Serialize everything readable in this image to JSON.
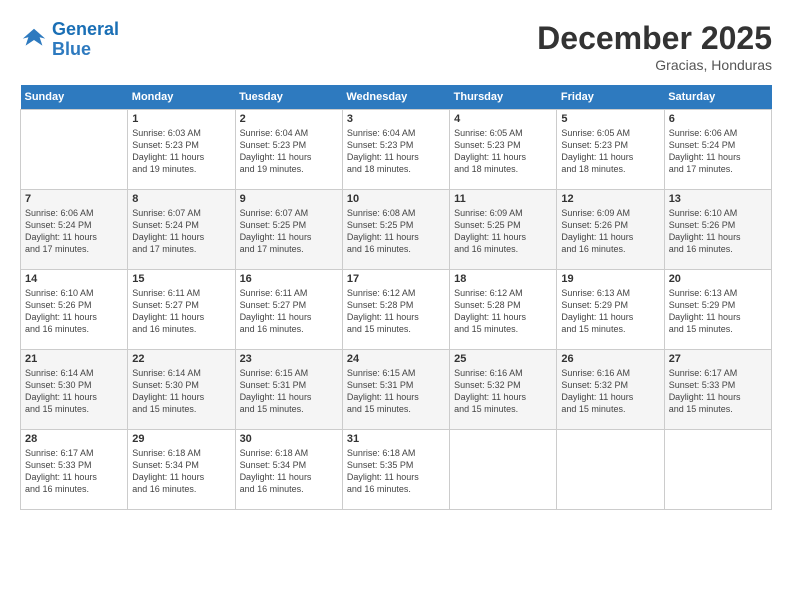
{
  "header": {
    "logo_line1": "General",
    "logo_line2": "Blue",
    "month": "December 2025",
    "location": "Gracias, Honduras"
  },
  "days_of_week": [
    "Sunday",
    "Monday",
    "Tuesday",
    "Wednesday",
    "Thursday",
    "Friday",
    "Saturday"
  ],
  "weeks": [
    [
      {
        "num": "",
        "info": ""
      },
      {
        "num": "1",
        "info": "Sunrise: 6:03 AM\nSunset: 5:23 PM\nDaylight: 11 hours\nand 19 minutes."
      },
      {
        "num": "2",
        "info": "Sunrise: 6:04 AM\nSunset: 5:23 PM\nDaylight: 11 hours\nand 19 minutes."
      },
      {
        "num": "3",
        "info": "Sunrise: 6:04 AM\nSunset: 5:23 PM\nDaylight: 11 hours\nand 18 minutes."
      },
      {
        "num": "4",
        "info": "Sunrise: 6:05 AM\nSunset: 5:23 PM\nDaylight: 11 hours\nand 18 minutes."
      },
      {
        "num": "5",
        "info": "Sunrise: 6:05 AM\nSunset: 5:23 PM\nDaylight: 11 hours\nand 18 minutes."
      },
      {
        "num": "6",
        "info": "Sunrise: 6:06 AM\nSunset: 5:24 PM\nDaylight: 11 hours\nand 17 minutes."
      }
    ],
    [
      {
        "num": "7",
        "info": "Sunrise: 6:06 AM\nSunset: 5:24 PM\nDaylight: 11 hours\nand 17 minutes."
      },
      {
        "num": "8",
        "info": "Sunrise: 6:07 AM\nSunset: 5:24 PM\nDaylight: 11 hours\nand 17 minutes."
      },
      {
        "num": "9",
        "info": "Sunrise: 6:07 AM\nSunset: 5:25 PM\nDaylight: 11 hours\nand 17 minutes."
      },
      {
        "num": "10",
        "info": "Sunrise: 6:08 AM\nSunset: 5:25 PM\nDaylight: 11 hours\nand 16 minutes."
      },
      {
        "num": "11",
        "info": "Sunrise: 6:09 AM\nSunset: 5:25 PM\nDaylight: 11 hours\nand 16 minutes."
      },
      {
        "num": "12",
        "info": "Sunrise: 6:09 AM\nSunset: 5:26 PM\nDaylight: 11 hours\nand 16 minutes."
      },
      {
        "num": "13",
        "info": "Sunrise: 6:10 AM\nSunset: 5:26 PM\nDaylight: 11 hours\nand 16 minutes."
      }
    ],
    [
      {
        "num": "14",
        "info": "Sunrise: 6:10 AM\nSunset: 5:26 PM\nDaylight: 11 hours\nand 16 minutes."
      },
      {
        "num": "15",
        "info": "Sunrise: 6:11 AM\nSunset: 5:27 PM\nDaylight: 11 hours\nand 16 minutes."
      },
      {
        "num": "16",
        "info": "Sunrise: 6:11 AM\nSunset: 5:27 PM\nDaylight: 11 hours\nand 16 minutes."
      },
      {
        "num": "17",
        "info": "Sunrise: 6:12 AM\nSunset: 5:28 PM\nDaylight: 11 hours\nand 15 minutes."
      },
      {
        "num": "18",
        "info": "Sunrise: 6:12 AM\nSunset: 5:28 PM\nDaylight: 11 hours\nand 15 minutes."
      },
      {
        "num": "19",
        "info": "Sunrise: 6:13 AM\nSunset: 5:29 PM\nDaylight: 11 hours\nand 15 minutes."
      },
      {
        "num": "20",
        "info": "Sunrise: 6:13 AM\nSunset: 5:29 PM\nDaylight: 11 hours\nand 15 minutes."
      }
    ],
    [
      {
        "num": "21",
        "info": "Sunrise: 6:14 AM\nSunset: 5:30 PM\nDaylight: 11 hours\nand 15 minutes."
      },
      {
        "num": "22",
        "info": "Sunrise: 6:14 AM\nSunset: 5:30 PM\nDaylight: 11 hours\nand 15 minutes."
      },
      {
        "num": "23",
        "info": "Sunrise: 6:15 AM\nSunset: 5:31 PM\nDaylight: 11 hours\nand 15 minutes."
      },
      {
        "num": "24",
        "info": "Sunrise: 6:15 AM\nSunset: 5:31 PM\nDaylight: 11 hours\nand 15 minutes."
      },
      {
        "num": "25",
        "info": "Sunrise: 6:16 AM\nSunset: 5:32 PM\nDaylight: 11 hours\nand 15 minutes."
      },
      {
        "num": "26",
        "info": "Sunrise: 6:16 AM\nSunset: 5:32 PM\nDaylight: 11 hours\nand 15 minutes."
      },
      {
        "num": "27",
        "info": "Sunrise: 6:17 AM\nSunset: 5:33 PM\nDaylight: 11 hours\nand 15 minutes."
      }
    ],
    [
      {
        "num": "28",
        "info": "Sunrise: 6:17 AM\nSunset: 5:33 PM\nDaylight: 11 hours\nand 16 minutes."
      },
      {
        "num": "29",
        "info": "Sunrise: 6:18 AM\nSunset: 5:34 PM\nDaylight: 11 hours\nand 16 minutes."
      },
      {
        "num": "30",
        "info": "Sunrise: 6:18 AM\nSunset: 5:34 PM\nDaylight: 11 hours\nand 16 minutes."
      },
      {
        "num": "31",
        "info": "Sunrise: 6:18 AM\nSunset: 5:35 PM\nDaylight: 11 hours\nand 16 minutes."
      },
      {
        "num": "",
        "info": ""
      },
      {
        "num": "",
        "info": ""
      },
      {
        "num": "",
        "info": ""
      }
    ]
  ]
}
